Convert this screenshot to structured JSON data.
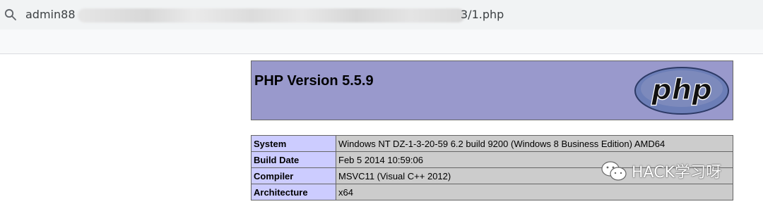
{
  "browser": {
    "url_prefix": "admin88",
    "url_suffix": "3/1.php",
    "icons": {
      "search": "search-icon"
    }
  },
  "phpinfo": {
    "title": "PHP Version 5.5.9",
    "logo_text": "php",
    "colors": {
      "header_bg": "#9999cc",
      "key_bg": "#ccccff",
      "value_bg": "#cccccc"
    },
    "rows": [
      {
        "key": "System",
        "value": "Windows NT DZ-1-3-20-59 6.2 build 9200 (Windows 8 Business Edition) AMD64"
      },
      {
        "key": "Build Date",
        "value": "Feb 5 2014 10:59:06"
      },
      {
        "key": "Compiler",
        "value": "MSVC11 (Visual C++ 2012)"
      },
      {
        "key": "Architecture",
        "value": "x64"
      }
    ]
  },
  "watermark": {
    "icon": "wechat-icon",
    "text": "HACK学习呀"
  }
}
